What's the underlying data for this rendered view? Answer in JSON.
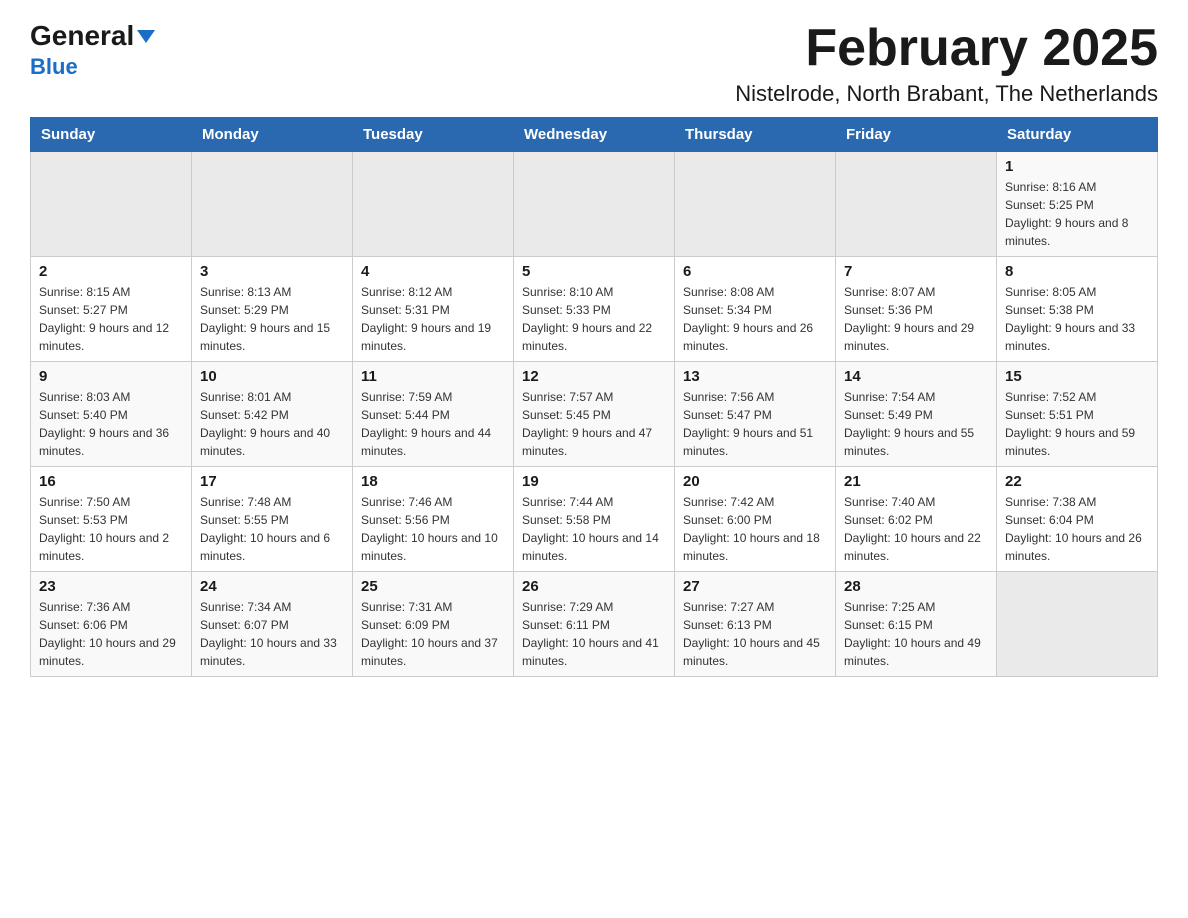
{
  "header": {
    "logo_line1": "General",
    "logo_line2": "Blue",
    "month_title": "February 2025",
    "location": "Nistelrode, North Brabant, The Netherlands"
  },
  "days_of_week": [
    "Sunday",
    "Monday",
    "Tuesday",
    "Wednesday",
    "Thursday",
    "Friday",
    "Saturday"
  ],
  "weeks": [
    {
      "days": [
        {
          "num": "",
          "info": ""
        },
        {
          "num": "",
          "info": ""
        },
        {
          "num": "",
          "info": ""
        },
        {
          "num": "",
          "info": ""
        },
        {
          "num": "",
          "info": ""
        },
        {
          "num": "",
          "info": ""
        },
        {
          "num": "1",
          "info": "Sunrise: 8:16 AM\nSunset: 5:25 PM\nDaylight: 9 hours and 8 minutes."
        }
      ]
    },
    {
      "days": [
        {
          "num": "2",
          "info": "Sunrise: 8:15 AM\nSunset: 5:27 PM\nDaylight: 9 hours and 12 minutes."
        },
        {
          "num": "3",
          "info": "Sunrise: 8:13 AM\nSunset: 5:29 PM\nDaylight: 9 hours and 15 minutes."
        },
        {
          "num": "4",
          "info": "Sunrise: 8:12 AM\nSunset: 5:31 PM\nDaylight: 9 hours and 19 minutes."
        },
        {
          "num": "5",
          "info": "Sunrise: 8:10 AM\nSunset: 5:33 PM\nDaylight: 9 hours and 22 minutes."
        },
        {
          "num": "6",
          "info": "Sunrise: 8:08 AM\nSunset: 5:34 PM\nDaylight: 9 hours and 26 minutes."
        },
        {
          "num": "7",
          "info": "Sunrise: 8:07 AM\nSunset: 5:36 PM\nDaylight: 9 hours and 29 minutes."
        },
        {
          "num": "8",
          "info": "Sunrise: 8:05 AM\nSunset: 5:38 PM\nDaylight: 9 hours and 33 minutes."
        }
      ]
    },
    {
      "days": [
        {
          "num": "9",
          "info": "Sunrise: 8:03 AM\nSunset: 5:40 PM\nDaylight: 9 hours and 36 minutes."
        },
        {
          "num": "10",
          "info": "Sunrise: 8:01 AM\nSunset: 5:42 PM\nDaylight: 9 hours and 40 minutes."
        },
        {
          "num": "11",
          "info": "Sunrise: 7:59 AM\nSunset: 5:44 PM\nDaylight: 9 hours and 44 minutes."
        },
        {
          "num": "12",
          "info": "Sunrise: 7:57 AM\nSunset: 5:45 PM\nDaylight: 9 hours and 47 minutes."
        },
        {
          "num": "13",
          "info": "Sunrise: 7:56 AM\nSunset: 5:47 PM\nDaylight: 9 hours and 51 minutes."
        },
        {
          "num": "14",
          "info": "Sunrise: 7:54 AM\nSunset: 5:49 PM\nDaylight: 9 hours and 55 minutes."
        },
        {
          "num": "15",
          "info": "Sunrise: 7:52 AM\nSunset: 5:51 PM\nDaylight: 9 hours and 59 minutes."
        }
      ]
    },
    {
      "days": [
        {
          "num": "16",
          "info": "Sunrise: 7:50 AM\nSunset: 5:53 PM\nDaylight: 10 hours and 2 minutes."
        },
        {
          "num": "17",
          "info": "Sunrise: 7:48 AM\nSunset: 5:55 PM\nDaylight: 10 hours and 6 minutes."
        },
        {
          "num": "18",
          "info": "Sunrise: 7:46 AM\nSunset: 5:56 PM\nDaylight: 10 hours and 10 minutes."
        },
        {
          "num": "19",
          "info": "Sunrise: 7:44 AM\nSunset: 5:58 PM\nDaylight: 10 hours and 14 minutes."
        },
        {
          "num": "20",
          "info": "Sunrise: 7:42 AM\nSunset: 6:00 PM\nDaylight: 10 hours and 18 minutes."
        },
        {
          "num": "21",
          "info": "Sunrise: 7:40 AM\nSunset: 6:02 PM\nDaylight: 10 hours and 22 minutes."
        },
        {
          "num": "22",
          "info": "Sunrise: 7:38 AM\nSunset: 6:04 PM\nDaylight: 10 hours and 26 minutes."
        }
      ]
    },
    {
      "days": [
        {
          "num": "23",
          "info": "Sunrise: 7:36 AM\nSunset: 6:06 PM\nDaylight: 10 hours and 29 minutes."
        },
        {
          "num": "24",
          "info": "Sunrise: 7:34 AM\nSunset: 6:07 PM\nDaylight: 10 hours and 33 minutes."
        },
        {
          "num": "25",
          "info": "Sunrise: 7:31 AM\nSunset: 6:09 PM\nDaylight: 10 hours and 37 minutes."
        },
        {
          "num": "26",
          "info": "Sunrise: 7:29 AM\nSunset: 6:11 PM\nDaylight: 10 hours and 41 minutes."
        },
        {
          "num": "27",
          "info": "Sunrise: 7:27 AM\nSunset: 6:13 PM\nDaylight: 10 hours and 45 minutes."
        },
        {
          "num": "28",
          "info": "Sunrise: 7:25 AM\nSunset: 6:15 PM\nDaylight: 10 hours and 49 minutes."
        },
        {
          "num": "",
          "info": ""
        }
      ]
    }
  ]
}
